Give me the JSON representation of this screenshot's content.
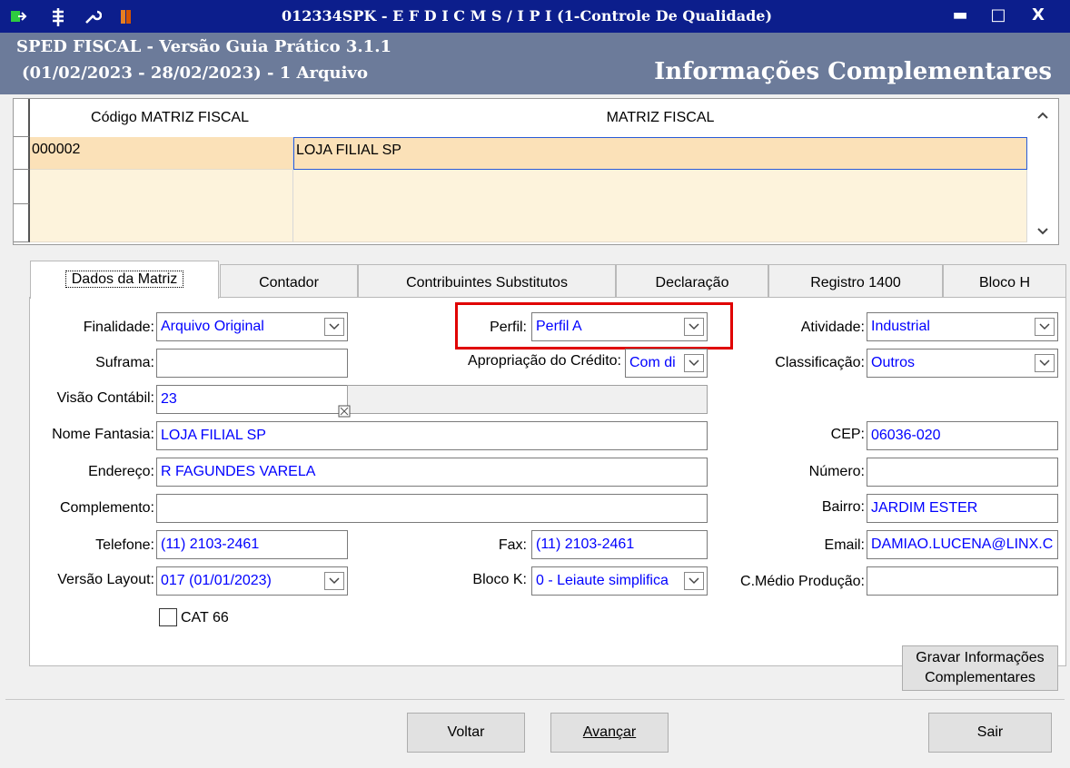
{
  "window": {
    "title": "012334SPK - E F D  I C M S / I P I (1-Controle De Qualidade)",
    "minimize": "▬",
    "maximize": "□",
    "close": "X"
  },
  "header": {
    "line1": "SPED FISCAL - Versão Guia Prático 3.1.1",
    "line2": "(01/02/2023 - 28/02/2023) - 1 Arquivo",
    "section": "Informações Complementares"
  },
  "grid": {
    "columns": [
      "Código MATRIZ FISCAL",
      "MATRIZ FISCAL"
    ],
    "rows": [
      [
        "000002",
        "LOJA FILIAL SP"
      ]
    ]
  },
  "tabs": [
    "Dados da Matriz",
    "Contador",
    "Contribuintes Substitutos",
    "Declaração",
    "Registro 1400",
    "Bloco H"
  ],
  "form": {
    "finalidade": {
      "label": "Finalidade:",
      "value": "Arquivo Original"
    },
    "perfil": {
      "label": "Perfil:",
      "value": "Perfil A"
    },
    "atividade": {
      "label": "Atividade:",
      "value": "Industrial"
    },
    "suframa": {
      "label": "Suframa:",
      "value": ""
    },
    "apropriacao": {
      "label": "Apropriação do Crédito:",
      "value": "Com di"
    },
    "classificacao": {
      "label": "Classificação:",
      "value": "Outros"
    },
    "visao": {
      "label": "Visão Contábil:",
      "value": "23"
    },
    "nome_fantasia": {
      "label": "Nome Fantasia:",
      "value": "LOJA FILIAL SP"
    },
    "cep": {
      "label": "CEP:",
      "value": "06036-020"
    },
    "endereco": {
      "label": "Endereço:",
      "value": "R FAGUNDES VARELA"
    },
    "numero": {
      "label": "Número:",
      "value": ""
    },
    "complemento": {
      "label": "Complemento:",
      "value": ""
    },
    "bairro": {
      "label": "Bairro:",
      "value": "JARDIM ESTER"
    },
    "telefone": {
      "label": "Telefone:",
      "value": "(11) 2103-2461"
    },
    "fax": {
      "label": "Fax:",
      "value": "(11) 2103-2461"
    },
    "email": {
      "label": "Email:",
      "value": "DAMIAO.LUCENA@LINX.C"
    },
    "versao_layout": {
      "label": "Versão Layout:",
      "value": "017 (01/01/2023)"
    },
    "bloco_k": {
      "label": "Bloco K:",
      "value": "0 - Leiaute simplifica"
    },
    "cmedio": {
      "label": "C.Médio Produção:",
      "value": ""
    },
    "cat66": {
      "label": "CAT 66",
      "checked": false
    }
  },
  "buttons": {
    "gravar_line1": "Gravar Informações",
    "gravar_line2": "Complementares",
    "voltar": "Voltar",
    "avancar": "Avançar",
    "sair": "Sair"
  },
  "highlight_color": "#e00000"
}
